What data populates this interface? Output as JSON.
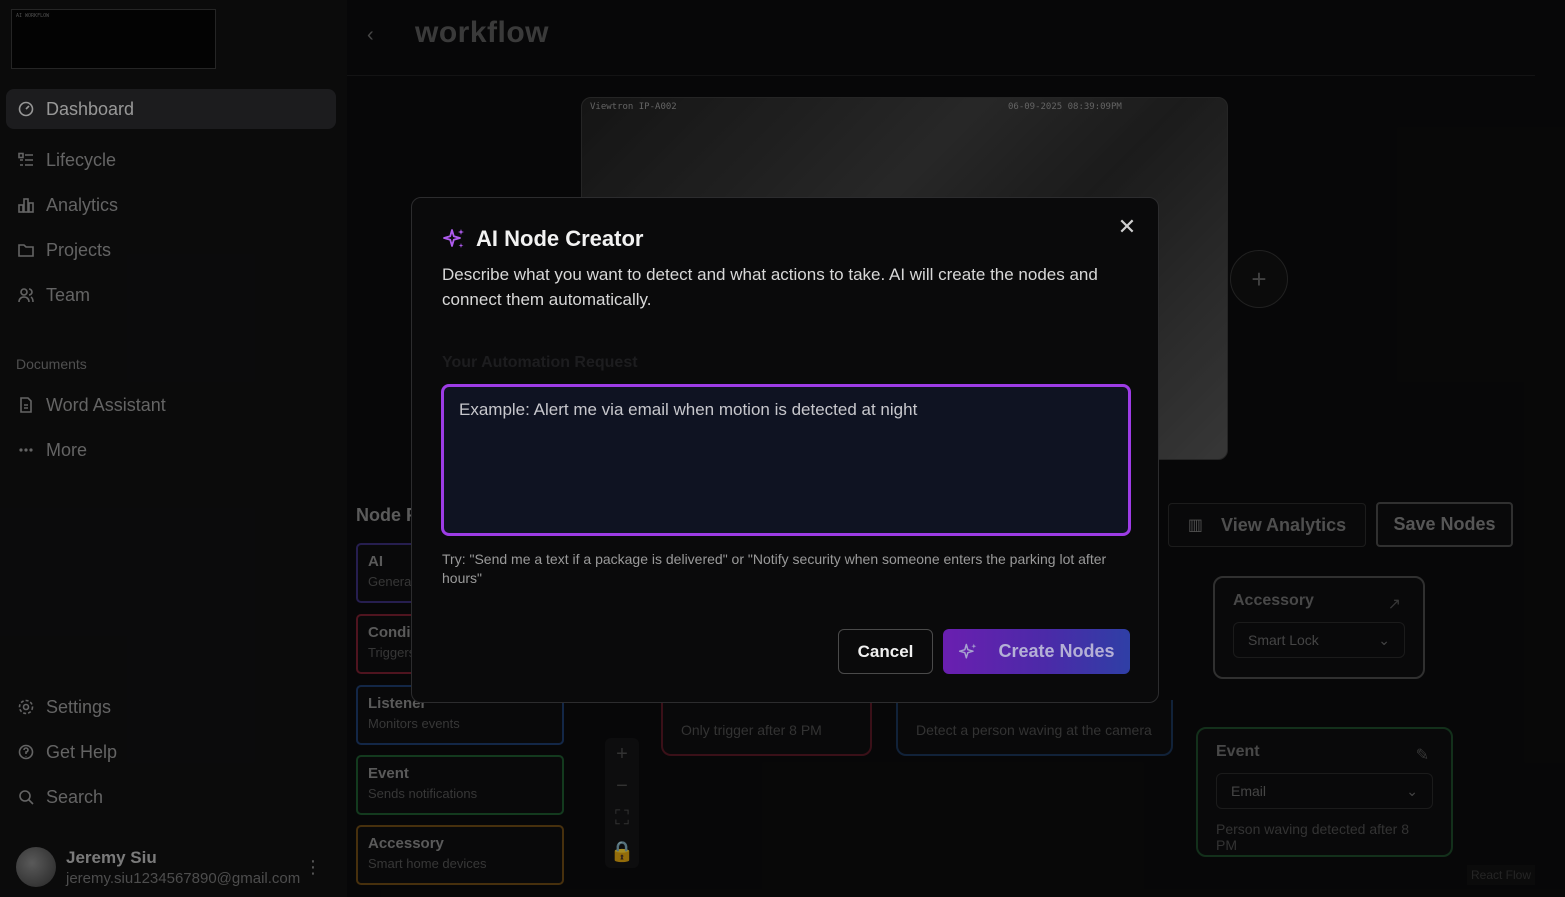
{
  "sidebar": {
    "logo_text": "AI WORKFLOW",
    "nav": [
      {
        "label": "Dashboard",
        "icon": "dashboard-icon",
        "active": true
      },
      {
        "label": "Lifecycle",
        "icon": "list-icon"
      },
      {
        "label": "Analytics",
        "icon": "bar-chart-icon"
      },
      {
        "label": "Projects",
        "icon": "folder-icon"
      },
      {
        "label": "Team",
        "icon": "users-icon"
      }
    ],
    "documents_label": "Documents",
    "documents": [
      {
        "label": "Word Assistant",
        "icon": "document-icon"
      },
      {
        "label": "More",
        "icon": "more-icon"
      }
    ],
    "footer": [
      {
        "label": "Settings",
        "icon": "settings-icon"
      },
      {
        "label": "Get Help",
        "icon": "help-icon"
      },
      {
        "label": "Search",
        "icon": "search-icon"
      }
    ],
    "user": {
      "name": "Jeremy Siu",
      "email": "jeremy.siu1234567890@gmail.com"
    }
  },
  "header": {
    "title": "workflow"
  },
  "camera": {
    "label_left": "Viewtron IP-A002",
    "timestamp": "06-09-2025 08:39:09PM"
  },
  "node_panel": {
    "title": "Node P",
    "cards": [
      {
        "title": "AI",
        "subtitle": "Genera",
        "color": "#3b2f7a"
      },
      {
        "title": "Condi",
        "subtitle": "Triggers",
        "color": "#7a2030"
      },
      {
        "title": "Listener",
        "subtitle": "Monitors events",
        "color": "#1e3d6e"
      },
      {
        "title": "Event",
        "subtitle": "Sends notifications",
        "color": "#1e5a2e"
      },
      {
        "title": "Accessory",
        "subtitle": "Smart home devices",
        "color": "#6e4a14"
      }
    ]
  },
  "toolbar": {
    "view_analytics": "View Analytics",
    "save_nodes": "Save Nodes"
  },
  "flow": {
    "accessory": {
      "title": "Accessory",
      "value": "Smart Lock"
    },
    "event": {
      "title": "Event",
      "value": "Email",
      "description": "Person waving detected after 8 PM"
    },
    "condition_text": "Only trigger after 8 PM",
    "listener_text": "Detect a person waving at the camera",
    "watermark": "React Flow"
  },
  "modal": {
    "title": "AI Node Creator",
    "description": "Describe what you want to detect and what actions to take. AI will create the nodes and connect them automatically.",
    "field_label": "Your Automation Request",
    "placeholder": "Example: Alert me via email when motion is detected at night",
    "hint": "Try: \"Send me a text if a package is delivered\" or \"Notify security when someone enters the parking lot after hours\"",
    "cancel": "Cancel",
    "create": "Create Nodes",
    "accent": "#9d3ce6"
  }
}
